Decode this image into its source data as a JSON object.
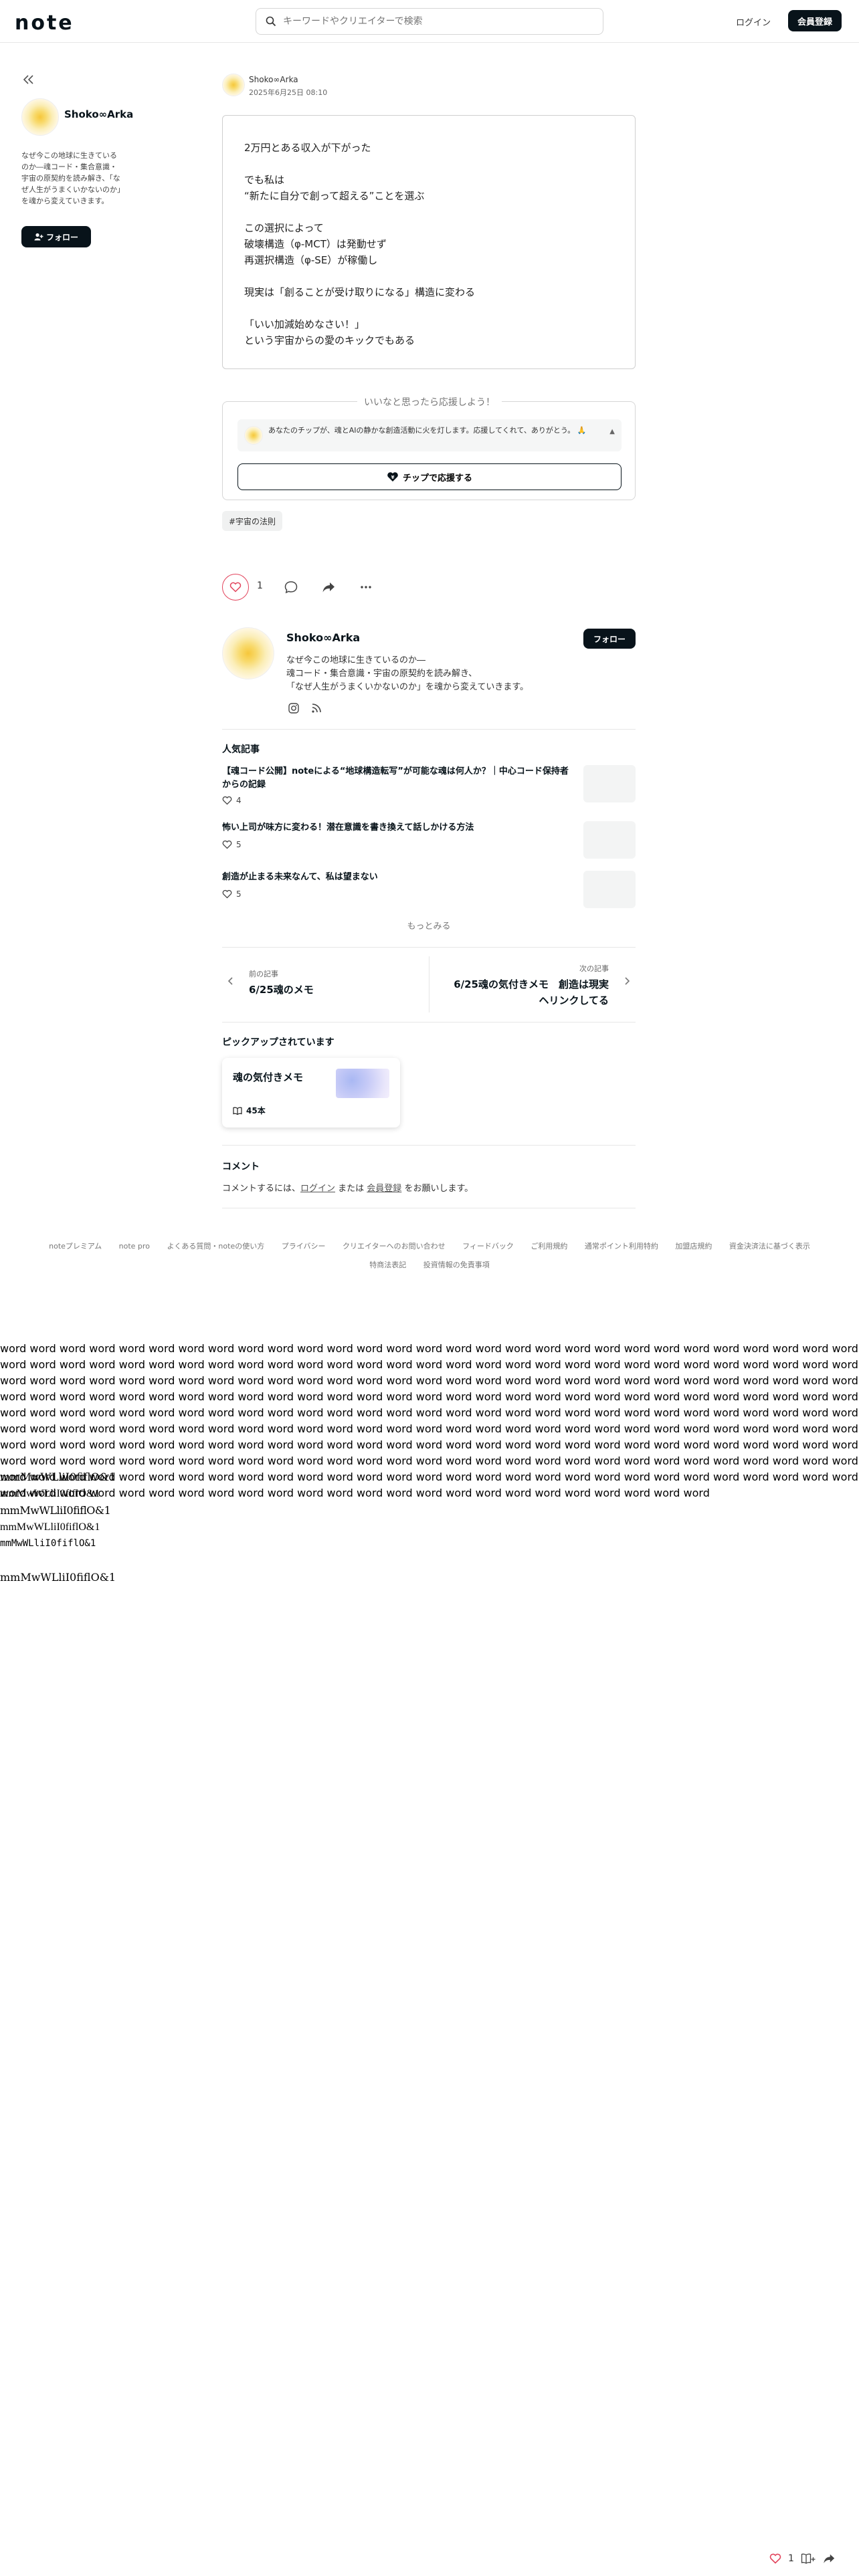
{
  "header": {
    "logo": "note",
    "search_placeholder": "キーワードやクリエイターで検索",
    "login": "ログイン",
    "signup": "会員登録"
  },
  "sidebar": {
    "name": "Shoko∞Arka",
    "bio": "なぜ今この地球に生きているのか―魂コード・集合意識・宇宙の原契約を読み解き、「なぜ人生がうまくいかないのか」を魂から変えていきます。",
    "follow": "フォロー"
  },
  "article": {
    "author": "Shoko∞Arka",
    "date": "2025年6月25日 08:10",
    "paragraphs": [
      "2万円とある収入が下がった",
      "でも私は\n“新たに自分で創って超える”ことを選ぶ",
      "この選択によって\n破壊構造（φ-MCT）は発動せず\n再選択構造（φ-SE）が稼働し",
      "現実は「創ることが受け取りになる」構造に変わる",
      "「いい加減始めなさい！」\nという宇宙からの愛のキックでもある"
    ]
  },
  "tip": {
    "title": "いいなと思ったら応援しよう！",
    "message": "あなたのチップが、魂とAIの静かな創造活動に火を灯します。応援してくれて、ありがとう。",
    "message_tail": "🙏",
    "button": "チップで応援する"
  },
  "hashtag": "#宇宙の法則",
  "actions": {
    "like_count": "1"
  },
  "author_card": {
    "name": "Shoko∞Arka",
    "follow": "フォロー",
    "bio_lines": [
      "なぜ今この地球に生きているのか―",
      "魂コード・集合意識・宇宙の原契約を読み解き、",
      "「なぜ人生がうまくいかないのか」を魂から変えていきます。"
    ]
  },
  "popular": {
    "title": "人気記事",
    "items": [
      {
        "title": "【魂コード公開】noteによる“地球構造転写”が可能な魂は何人か？｜中心コード保持者からの記録",
        "likes": "4"
      },
      {
        "title": "怖い上司が味方に変わる！潜在意識を書き換えて話しかける方法",
        "likes": "5"
      },
      {
        "title": "創造が止まる未来なんて、私は望まない",
        "likes": "5"
      }
    ],
    "more": "もっとみる"
  },
  "nav": {
    "prev_label": "前の記事",
    "prev_title": "6/25魂のメモ",
    "next_label": "次の記事",
    "next_title": "6/25魂の気付きメモ　創造は現実ヘリンクしてる"
  },
  "pickup": {
    "title": "ピックアップされています",
    "card_title": "魂の気付きメモ",
    "count": "45本"
  },
  "comments": {
    "title": "コメント",
    "prefix": "コメントするには、",
    "login": "ログイン",
    "middle": " または ",
    "signup": "会員登録",
    "suffix": " をお願いします。"
  },
  "footer": {
    "links_row1": [
      "noteプレミアム",
      "note pro",
      "よくある質問・noteの使い方",
      "プライバシー",
      "クリエイターへのお問い合わせ",
      "フィードバック",
      "ご利用規約",
      "通常ポイント利用特約",
      "加盟店規約",
      "資金決済法に基づく表示"
    ],
    "links_row2": [
      "特商法表記",
      "投資情報の免責事項"
    ]
  },
  "filler": {
    "words": "word word word word word word word word word word word word word word word word word word word word word word word word word word word word word word word word word word word word word word word word word word word word word word word word word word word word word word word word word word word word word word word word word word word word word word word word word word word word word word word word word word word word word word word word word word word word word word word word word word word word word word word word word word word word word word word word word word word word word word word word word word word word word word word word word word word word word word word word word word word word word word word word word word word word word word word word word word word word word word word word word word word word word word word word word word word word word word word word word word word word word word word word word word word word word word word word word word word word word word word word word word word word word word word word word word word word word word word word word word word word word word word word word word word word word word word word word word word word word word word word word word word word word word word word word word word word word word word word word word word word word word word word word word word word word word word word word word word word word word word word word word word word word",
    "glyph_lines": [
      "mmMwWLliI0fiflO&1",
      "mmMwWLliI0fiflO&1",
      "mmMwWLliI0fiflO&1",
      "mmMwWLliI0fiflO&1",
      "mmMwWLliI0fiflO&1",
      "",
      "mmMwWLliI0fiflO&1"
    ]
  },
  "bottom_bar": {
    "like_count": "1"
  }
}
